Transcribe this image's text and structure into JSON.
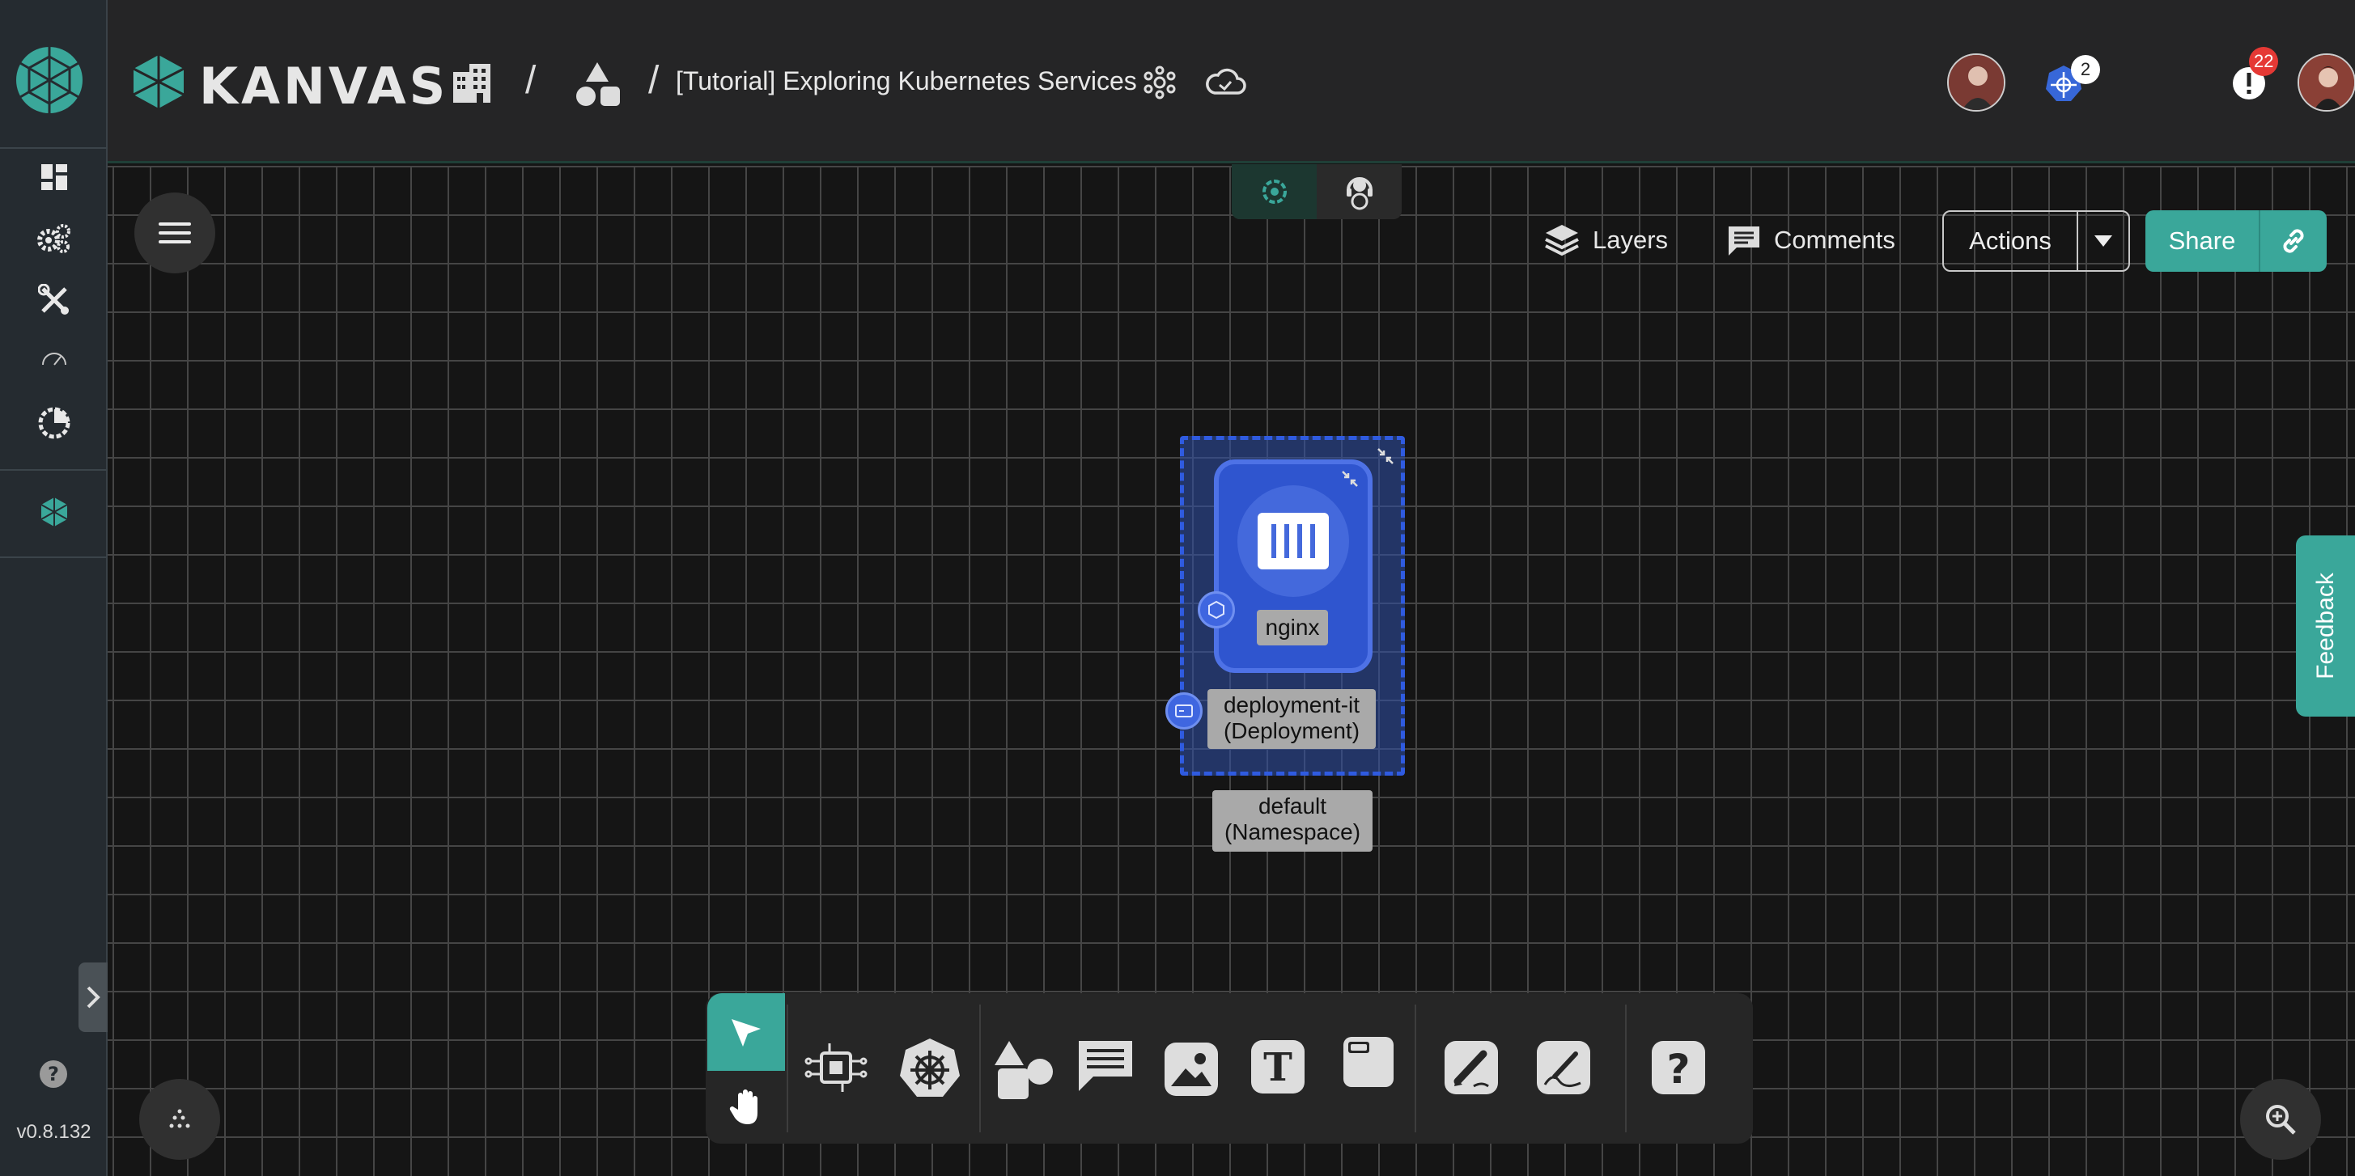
{
  "app": {
    "brand": "KANVAS",
    "version": "v0.8.132"
  },
  "header": {
    "breadcrumb_title": "[Tutorial] Exploring Kubernetes Services",
    "separator": "/",
    "kubernetes_badge_count": "2",
    "notification_count": "22"
  },
  "sidebar": {
    "items": [
      {
        "name": "dashboard-icon"
      },
      {
        "name": "gears-icon"
      },
      {
        "name": "tools-icon"
      },
      {
        "name": "gauge-icon"
      },
      {
        "name": "pie-chart-icon"
      },
      {
        "name": "kanvas-icon"
      }
    ]
  },
  "canvas_controls": {
    "layers_label": "Layers",
    "comments_label": "Comments",
    "actions_label": "Actions",
    "share_label": "Share",
    "feedback_label": "Feedback"
  },
  "diagram": {
    "pod_label": "nginx",
    "deployment_label_line1": "deployment-it",
    "deployment_label_line2": "(Deployment)",
    "namespace_label_line1": "default",
    "namespace_label_line2": "(Namespace)"
  },
  "toolbar": {
    "tools": [
      "pointer",
      "pan",
      "components",
      "kubernetes",
      "shapes",
      "comment",
      "image",
      "text",
      "section",
      "pen",
      "freehand",
      "help"
    ]
  },
  "colors": {
    "accent": "#3aa79a",
    "selection": "#2f5be0",
    "notification": "#e53935"
  }
}
